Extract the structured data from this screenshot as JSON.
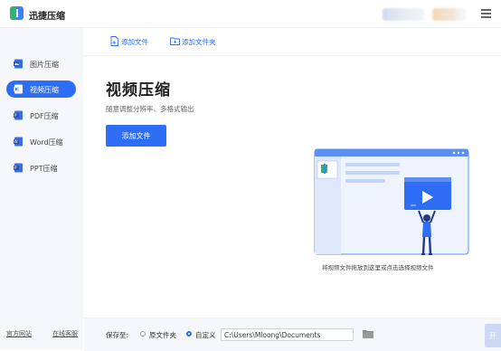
{
  "app": {
    "title": "迅捷压缩"
  },
  "sidebar": {
    "items": [
      {
        "label": "图片压缩",
        "icon": "image-file-icon",
        "active": false
      },
      {
        "label": "视频压缩",
        "icon": "video-file-icon",
        "active": true
      },
      {
        "label": "PDF压缩",
        "icon": "pdf-file-icon",
        "active": false
      },
      {
        "label": "Word压缩",
        "icon": "word-file-icon",
        "active": false
      },
      {
        "label": "PPT压缩",
        "icon": "ppt-file-icon",
        "active": false
      }
    ],
    "footer_links": [
      "官方网站",
      "在线客服"
    ]
  },
  "toolbar": {
    "add_file_label": "添加文件",
    "add_folder_label": "添加文件夹"
  },
  "main": {
    "heading": "视频压缩",
    "subheading": "随意调整分辨率、多格式输出",
    "add_file_button": "添加文件",
    "drop_hint": "将视频文件拖放到这里或点击选择视频文件"
  },
  "bottom": {
    "save_label": "保存至:",
    "option_source": "原文件夹",
    "option_custom": "自定义",
    "selected_option": "自定义",
    "path_value": "C:\\Users\\Mloong\\Documents",
    "start_button": "开"
  },
  "colors": {
    "accent": "#2e6ef6",
    "sidebar_bg": "#f5f7fb",
    "illustration_bg": "#eef3fc"
  }
}
